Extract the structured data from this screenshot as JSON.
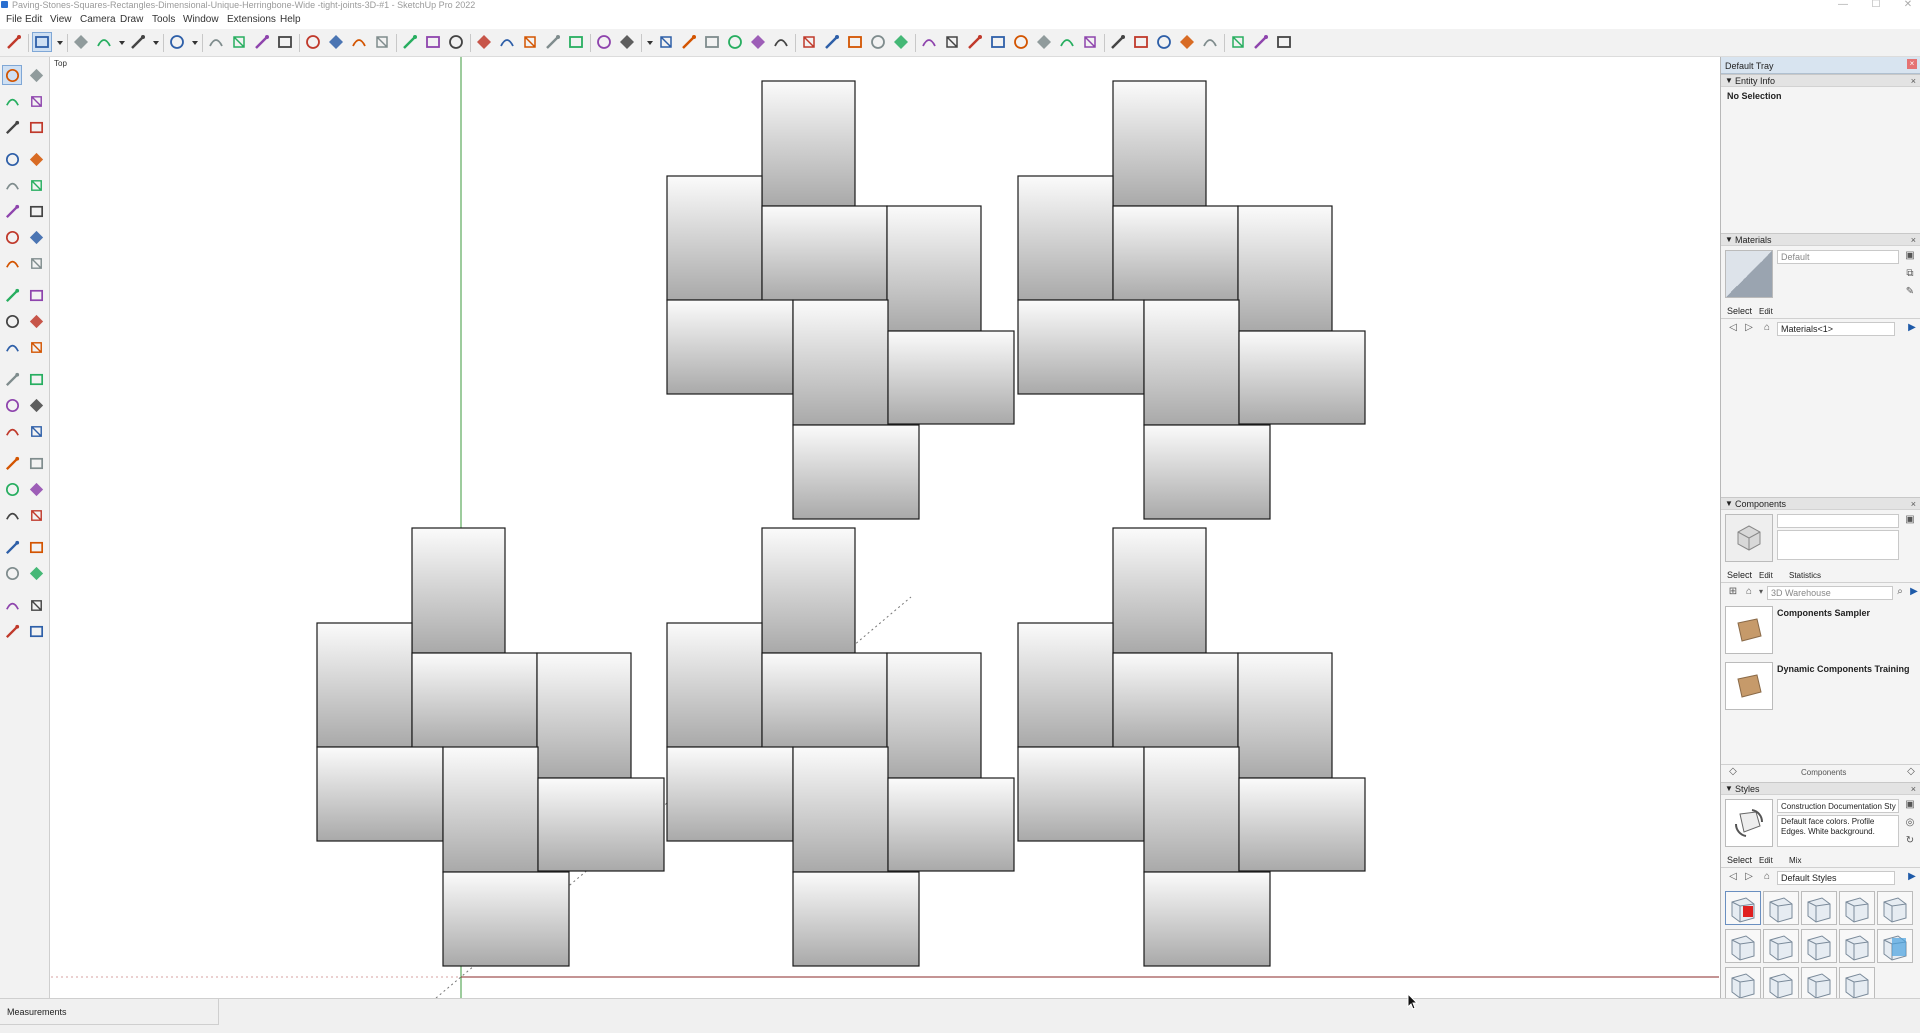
{
  "window": {
    "title": "Paving-Stones-Squares-Rectangles-Dimensional-Unique-Herringbone-Wide -tight-joints-3D-#1 - SketchUp Pro 2022",
    "controls": [
      "—",
      "☐",
      "✕"
    ]
  },
  "menu": [
    "File",
    "Edit",
    "View",
    "Camera",
    "Draw",
    "Tools",
    "Window",
    "Extensions",
    "Help"
  ],
  "toolbar_icons": [
    "search-icon",
    "select-icon",
    "select-dropdown-icon",
    "eraser-icon",
    "pencil-icon",
    "pencil-dropdown-icon",
    "shape-icon",
    "shape-dropdown-icon",
    "rectangle-icon",
    "rectangle-dropdown-icon",
    "push-pull-icon",
    "follow-me-icon",
    "move-icon",
    "rotate-icon",
    "scale-icon",
    "tape-measure-icon",
    "text-icon",
    "axes-icon",
    "paint-bucket-icon",
    "orbit-icon",
    "pan-icon",
    "zoom-icon",
    "zoom-extents-icon",
    "section-plane-icon",
    "section-display-icon",
    "section-fill-icon",
    "section-cut-icon",
    "user-icon",
    "user-dropdown-icon",
    "iso-view-icon",
    "top-view-icon",
    "home-icon",
    "front-view-icon",
    "right-view-icon",
    "back-view-icon",
    "left-view-icon",
    "xray-icon",
    "wireframe-icon",
    "hidden-line-icon",
    "shaded-icon",
    "textured-icon",
    "monochrome-icon",
    "component-icon",
    "arc-icon",
    "zoom-window-icon",
    "zoom-previous-icon",
    "extents-icon",
    "position-camera-icon",
    "walk-icon",
    "look-around-icon",
    "footprints-icon",
    "axes-move-icon",
    "warehouse-icon",
    "extension-warehouse-icon",
    "layout-icon",
    "send-icon"
  ],
  "left_tools": [
    "select-icon",
    "orbit-icon",
    "paint-bucket-icon",
    "eraser-icon",
    "section-icon",
    "tag-icon",
    "pencil-icon",
    "freehand-icon",
    "rectangle-icon",
    "rotated-rectangle-icon",
    "circle-icon",
    "polygon-icon",
    "arc-icon",
    "two-point-arc-icon",
    "three-point-arc-icon",
    "pie-icon",
    "move-icon",
    "push-pull-icon",
    "rotate-icon",
    "follow-me-icon",
    "scale-icon",
    "offset-icon",
    "tape-measure-icon",
    "dimension-icon",
    "protractor-icon",
    "text-icon",
    "axes-icon",
    "3d-text-icon",
    "orbit-icon",
    "pan-icon",
    "zoom-icon",
    "zoom-window-icon",
    "zoom-extents-icon",
    "previous-view-icon",
    "position-camera-icon",
    "look-around-icon",
    "walk-icon",
    "section-plane-icon",
    "section-display-icon",
    "section-cut-icon",
    "section-fill-icon",
    "section-plane-2-icon"
  ],
  "viewport": {
    "view_label": "Top",
    "tiles": [
      {
        "x": -1,
        "y": 1
      },
      {
        "x": -1,
        "y": 0
      },
      {
        "x": 0,
        "y": 0
      }
    ]
  },
  "tray": {
    "title": "Default Tray",
    "entity_info": {
      "header": "Entity Info",
      "text": "No Selection"
    },
    "materials": {
      "header": "Materials",
      "name": "Default",
      "tab_select": "Select",
      "tab_edit": "Edit",
      "collection": "Materials<1>"
    },
    "components": {
      "header": "Components",
      "tab_select": "Select",
      "tab_edit": "Edit",
      "tab_statistics": "Statistics",
      "search_placeholder": "3D Warehouse",
      "item1": "Components Sampler",
      "item2": "Dynamic Components Training",
      "footer": "Components"
    },
    "styles": {
      "header": "Styles",
      "name": "Construction Documentation Sty",
      "desc": "Default face colors. Profile Edges. White background.",
      "tab_select": "Select",
      "tab_edit": "Edit",
      "tab_mix": "Mix",
      "collection": "Default Styles"
    }
  },
  "status": {
    "measurements": "Measurements"
  }
}
